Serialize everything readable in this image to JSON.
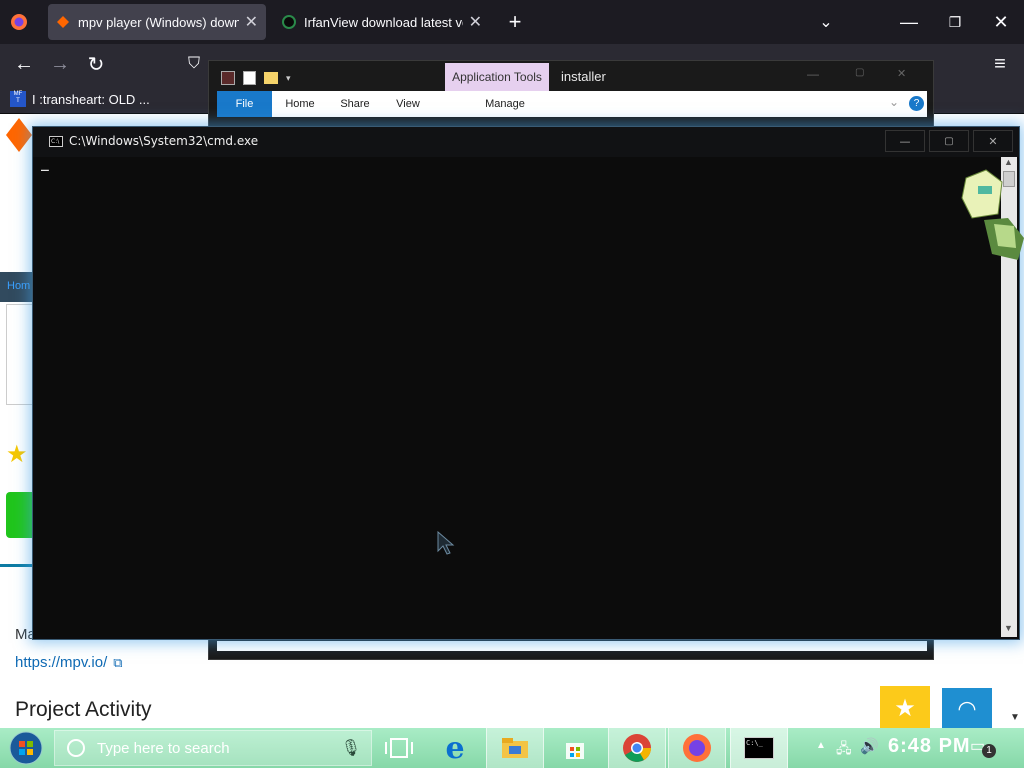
{
  "browser": {
    "tabs": [
      {
        "title": "mpv player (Windows) downloa",
        "active": true
      },
      {
        "title": "IrfanView download latest ve",
        "active": false
      }
    ],
    "bookmark": {
      "badge": "MF\nT",
      "label": "I :transheart: OLD ..."
    }
  },
  "page": {
    "home_link": "Hom",
    "homepage_label": "Ma",
    "url_link": "https://mpv.io/",
    "section_heading": "Project Activity"
  },
  "explorer": {
    "ribbon_context": "Application Tools",
    "title": "installer",
    "tabs": [
      "File",
      "Home",
      "Share",
      "View",
      "Manage"
    ]
  },
  "cmd": {
    "title": "C:\\Windows\\System32\\cmd.exe",
    "icon": "cmd-icon",
    "cursor": "_"
  },
  "taskbar": {
    "search_placeholder": "Type here to search",
    "time": "6:48 PM",
    "notification_count": "1"
  },
  "colors": {
    "browser_dark": "#1c1b22",
    "cmd_glow": "#46a0e6",
    "taskbar_green": "#9fe6bd",
    "ribbon_accent": "#1979ca"
  }
}
